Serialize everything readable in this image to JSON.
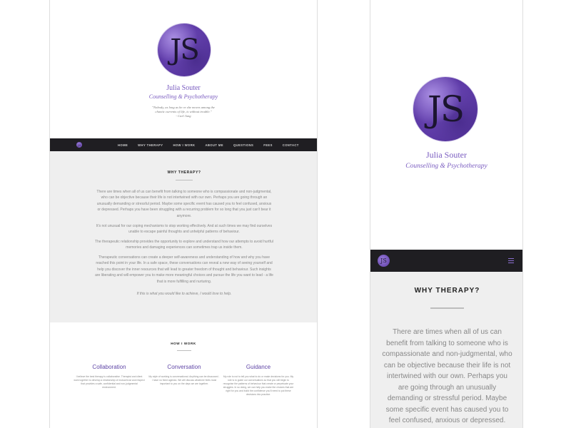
{
  "brand": {
    "monogram": "JS",
    "name": "Julia Souter",
    "tagline": "Counselling & Psychotherapy"
  },
  "quote": {
    "line1": "\"Nobody, as long as he or she moves among the",
    "line2": "chaotic currents of life, is without trouble.\"",
    "author": "- Carl Jung"
  },
  "nav": {
    "links": [
      "HOME",
      "WHY THERAPY",
      "HOW I WORK",
      "ABOUT ME",
      "QUESTIONS",
      "FEES",
      "CONTACT"
    ]
  },
  "why_therapy": {
    "title": "WHY THERAPY?",
    "p1": "There are times when all of us can benefit from talking to someone who is compassionate and non-judgmental, who can be objective because their life is not intertwined with our own. Perhaps you are going through an unusually demanding or stressful period. Maybe some specific event has caused you to feel confused, anxious or depressed. Perhaps you have been struggling with a recurring problem for so long that you just can't bear it anymore.",
    "p2": "It's not unusual for our coping mechanisms to stop working effectively. And at such times we may find ourselves unable to escape painful thoughts and unhelpful patterns of behaviour.",
    "p3": "The therapeutic relationship provides the opportunity to explore and understand how our attempts to avoid hurtful memories and damaging experiences can sometimes trap us inside them.",
    "p4": "Therapeutic conversations can create a deeper self-awareness and understanding of how and why you have reached this point in your life. In a safe space, these conversations can reveal a new way of seeing yourself and help you discover the inner resources that will lead to greater freedom of thought and behaviour. Such insights are liberating and will empower you to make more meaningful choices and pursue the life you want to lead - a life that is more fulfilling and nurturing.",
    "p5": "If this is what you would like to achieve, I would love to help."
  },
  "how_i_work": {
    "title": "HOW I WORK",
    "columns": [
      {
        "title": "Collaboration",
        "text": "I believe the best therapy is collaborative. Therapist and client work together to develop a relationship of mutual trust and respect that provides a safe, confidential and non-judgmental environment."
      },
      {
        "title": "Conversation",
        "text": "My style of working is conversational. Anything can be discussed - I have no fixed agenda. We will discuss whatever feels most important to you on the days we are together."
      },
      {
        "title": "Guidance",
        "text": "My role is not to tell you what to do or make decisions for you. My role is to guide our conversations so that you will begin to recognise the patterns of behaviour that create or perpetuate your struggles. In so doing, we can help you make the choices that are right for you and build the confidence you'll need to put these decisions into practice."
      }
    ]
  },
  "mobile": {
    "paragraph": "There are times when all of us can benefit from talking to someone who is compassionate and non-judgmental, who can be objective because their life is not intertwined with our own. Perhaps you are going through an unusually demanding or stressful period. Maybe some specific event has caused you to feel confused, anxious or depressed. Perhaps you have been struggling with a recurring problem"
  }
}
